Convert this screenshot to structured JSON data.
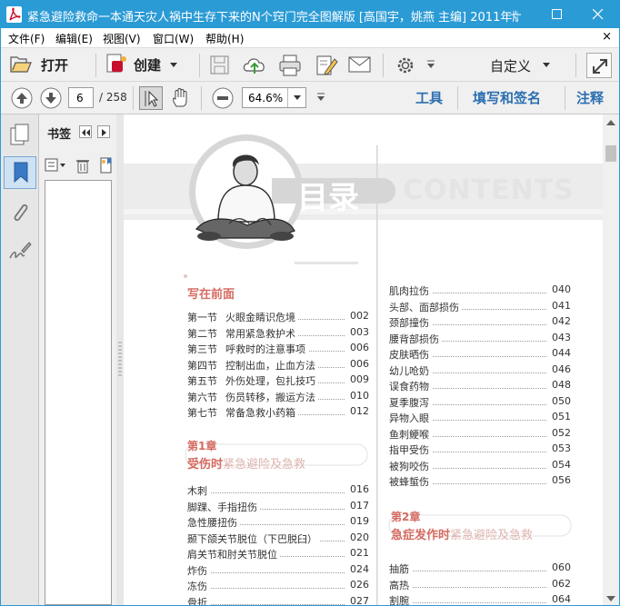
{
  "window": {
    "title": "紧急避险救命一本通天灾人祸中生存下来的N个窍门完全图解版 [高国宇，姚燕 主编] 2011年版...",
    "colors": {
      "titlebar": "#2b9bd6",
      "accent": "#2c6fb0",
      "toc_red": "#d46b61"
    }
  },
  "menu": [
    "文件(F)",
    "编辑(E)",
    "视图(V)",
    "窗口(W)",
    "帮助(H)"
  ],
  "menu_close": "×",
  "toolbar": {
    "open_label": "打开",
    "create_label": "创建",
    "custom_label": "自定义"
  },
  "nav": {
    "page_value": "6",
    "page_total": "/ 258",
    "zoom_value": "64.6%",
    "tools_label": "工具",
    "fill_sign_label": "填写和签名",
    "comment_label": "注释"
  },
  "bookmarks": {
    "title": "书签"
  },
  "doc": {
    "banner_title": "目录",
    "banner_sub": "CONTENTS",
    "left_col": {
      "intro": {
        "heading": "写在前面",
        "items": [
          {
            "num": "第一节",
            "text": "火眼金睛识危境",
            "page": "002"
          },
          {
            "num": "第二节",
            "text": "常用紧急救护术",
            "page": "003"
          },
          {
            "num": "第三节",
            "text": "呼救时的注意事项",
            "page": "006"
          },
          {
            "num": "第四节",
            "text": "控制出血，止血方法",
            "page": "006"
          },
          {
            "num": "第五节",
            "text": "外伤处理，包扎技巧",
            "page": "009"
          },
          {
            "num": "第六节",
            "text": "伤员转移，搬运方法",
            "page": "010"
          },
          {
            "num": "第七节",
            "text": "常备急救小药箱",
            "page": "012"
          }
        ]
      },
      "ch1": {
        "num": "第1章",
        "title_bold": "受伤时",
        "title_rest": "紧急避险及急救",
        "items": [
          {
            "text": "木刺",
            "page": "016"
          },
          {
            "text": "脚踝、手指扭伤",
            "page": "017"
          },
          {
            "text": "急性腰扭伤",
            "page": "019"
          },
          {
            "text": "颞下颌关节脱位（下巴脱臼）",
            "page": "020"
          },
          {
            "text": "肩关节和肘关节脱位",
            "page": "021"
          },
          {
            "text": "炸伤",
            "page": "024"
          },
          {
            "text": "冻伤",
            "page": "026"
          },
          {
            "text": "骨折",
            "page": "027"
          }
        ]
      }
    },
    "right_col": {
      "items": [
        {
          "text": "肌肉拉伤",
          "page": "040"
        },
        {
          "text": "头部、面部损伤",
          "page": "041"
        },
        {
          "text": "颈部撞伤",
          "page": "042"
        },
        {
          "text": "腰背部损伤",
          "page": "043"
        },
        {
          "text": "皮肤晒伤",
          "page": "044"
        },
        {
          "text": "幼儿呛奶",
          "page": "046"
        },
        {
          "text": "误食药物",
          "page": "048"
        },
        {
          "text": "夏季腹泻",
          "page": "050"
        },
        {
          "text": "异物入眼",
          "page": "051"
        },
        {
          "text": "鱼刺鲠喉",
          "page": "052"
        },
        {
          "text": "指甲受伤",
          "page": "053"
        },
        {
          "text": "被狗咬伤",
          "page": "054"
        },
        {
          "text": "被蜂蜇伤",
          "page": "056"
        }
      ],
      "ch2": {
        "num": "第2章",
        "title_bold": "急症发作时",
        "title_rest": "紧急避险及急救",
        "items": [
          {
            "text": "抽筋",
            "page": "060"
          },
          {
            "text": "高热",
            "page": "062"
          },
          {
            "text": "割腕",
            "page": "064"
          }
        ]
      }
    }
  }
}
